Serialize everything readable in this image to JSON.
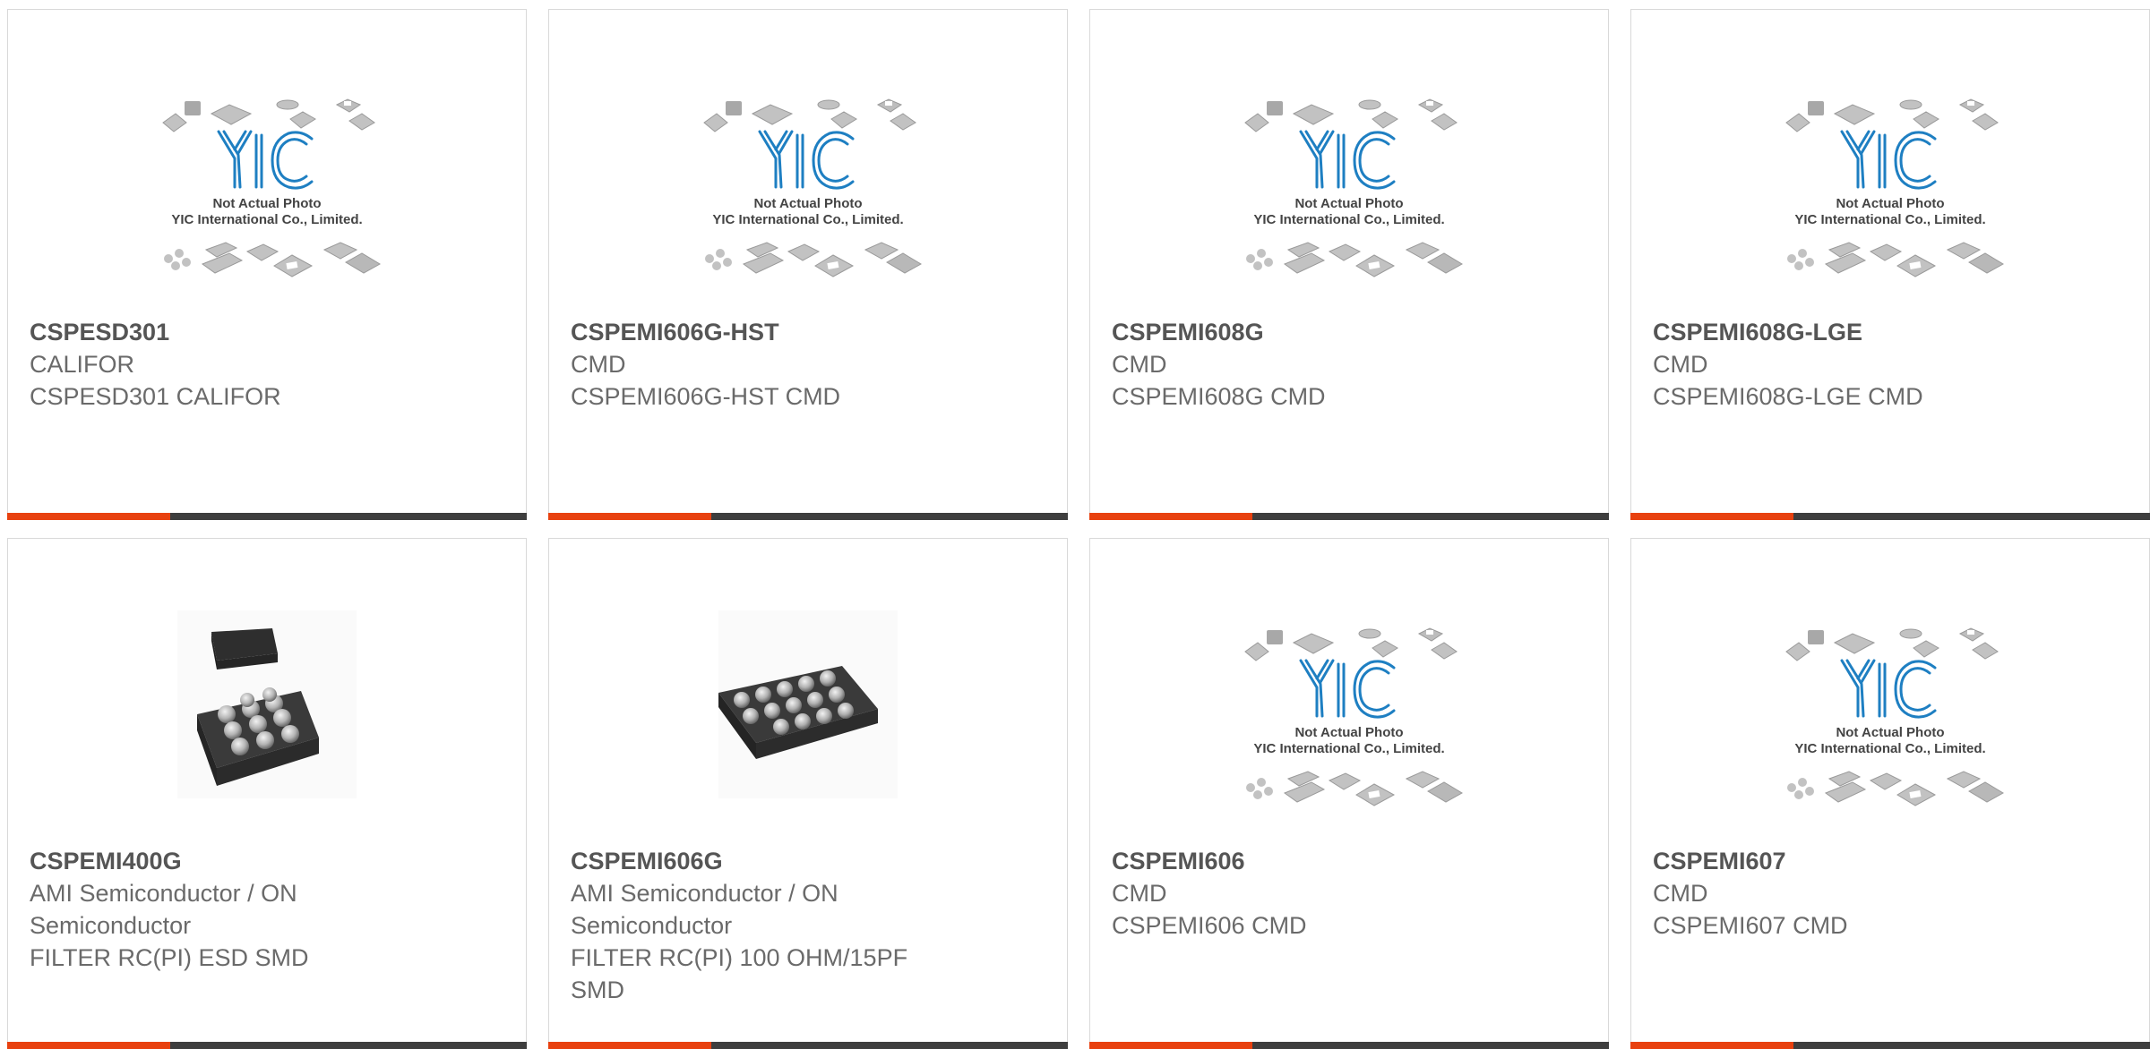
{
  "placeholder": {
    "logo_text": "YIC",
    "line1": "Not Actual Photo",
    "line2": "YIC International Co., Limited."
  },
  "colors": {
    "accent": "#e8410f",
    "bar": "#3e3e3e",
    "logo": "#1e7fc2"
  },
  "products": [
    {
      "part": "CSPESD301",
      "maker": "CALIFOR",
      "desc": "CSPESD301 CALIFOR",
      "image": "placeholder"
    },
    {
      "part": "CSPEMI606G-HST",
      "maker": "CMD",
      "desc": "CSPEMI606G-HST CMD",
      "image": "placeholder"
    },
    {
      "part": "CSPEMI608G",
      "maker": "CMD",
      "desc": "CSPEMI608G CMD",
      "image": "placeholder"
    },
    {
      "part": "CSPEMI608G-LGE",
      "maker": "CMD",
      "desc": "CSPEMI608G-LGE CMD",
      "image": "placeholder"
    },
    {
      "part": "CSPEMI400G",
      "maker": "AMI Semiconductor / ON Semiconductor",
      "desc": "FILTER RC(PI) ESD SMD",
      "image": "bga-chip-tall"
    },
    {
      "part": "CSPEMI606G",
      "maker": "AMI Semiconductor / ON Semiconductor",
      "desc": "FILTER RC(PI) 100 OHM/15PF SMD",
      "image": "bga-chip-flat"
    },
    {
      "part": "CSPEMI606",
      "maker": "CMD",
      "desc": "CSPEMI606 CMD",
      "image": "placeholder"
    },
    {
      "part": "CSPEMI607",
      "maker": "CMD",
      "desc": "CSPEMI607 CMD",
      "image": "placeholder"
    }
  ]
}
